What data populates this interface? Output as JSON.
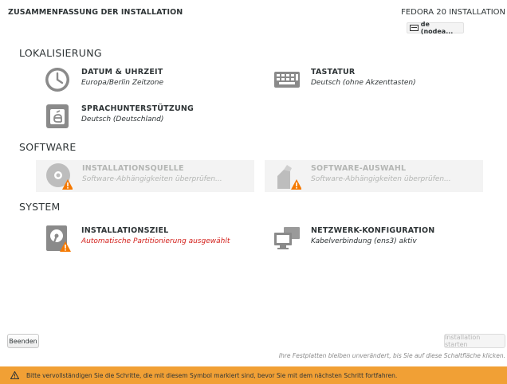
{
  "header": {
    "title": "ZUSAMMENFASSUNG DER INSTALLATION",
    "product": "FEDORA 20 INSTALLATION",
    "keyboard_layout": "de (nodea..."
  },
  "sections": {
    "localization": {
      "title": "LOKALISIERUNG",
      "spokes": {
        "datetime": {
          "title": "DATUM & UHRZEIT",
          "status": "Europa/Berlin Zeitzone",
          "icon": "clock-icon"
        },
        "keyboard": {
          "title": "TASTATUR",
          "status": "Deutsch (ohne Akzenttasten)",
          "icon": "keyboard-icon"
        },
        "language": {
          "title": "SPRACHUNTERSTÜTZUNG",
          "status": "Deutsch (Deutschland)",
          "icon": "language-icon"
        }
      }
    },
    "software": {
      "title": "SOFTWARE",
      "spokes": {
        "source": {
          "title": "INSTALLATIONSQUELLE",
          "status": "Software-Abhängigkeiten überprüfen...",
          "icon": "disc-icon"
        },
        "selection": {
          "title": "SOFTWARE-AUSWAHL",
          "status": "Software-Abhängigkeiten überprüfen...",
          "icon": "package-icon"
        }
      }
    },
    "system": {
      "title": "SYSTEM",
      "spokes": {
        "destination": {
          "title": "INSTALLATIONSZIEL",
          "status": "Automatische Partitionierung ausgewählt",
          "icon": "harddisk-icon"
        },
        "network": {
          "title": "NETZWERK-KONFIGURATION",
          "status": "Kabelverbindung (ens3) aktiv",
          "icon": "network-icon"
        }
      }
    }
  },
  "buttons": {
    "quit": "Beenden",
    "start": "Installation starten"
  },
  "hint": "Ihre Festplatten bleiben unverändert, bis Sie auf diese Schaltfläche klicken.",
  "warning_bar": {
    "text": "Bitte vervollständigen Sie die Schritte, die mit diesem Symbol markiert sind, bevor Sie mit dem nächsten Schritt fortfahren.",
    "color": "#f1a035"
  },
  "colors": {
    "icon_gray": "#8a8a8a",
    "warning_orange": "#f57900",
    "error_red": "#d3201b"
  }
}
